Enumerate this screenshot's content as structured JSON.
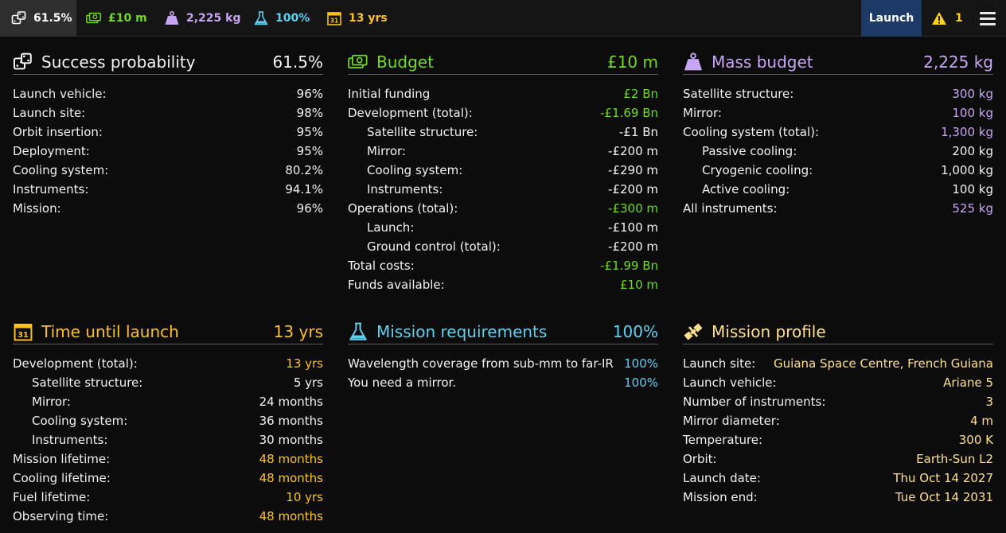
{
  "topbar": {
    "success": "61.5%",
    "budget": "£10 m",
    "mass": "2,225 kg",
    "requirements": "100%",
    "time": "13 yrs",
    "launch_label": "Launch",
    "warning_count": "1"
  },
  "colors": {
    "green": "#6fdc1c",
    "purple": "#c7a6f5",
    "cyan": "#5fd0f0",
    "yellow": "#ffc21a",
    "sand": "#ffe08a",
    "launch_bg": "#1d3a66"
  },
  "success": {
    "title": "Success probability",
    "value": "61.5%",
    "rows": [
      {
        "label": "Launch vehicle:",
        "value": "96%"
      },
      {
        "label": "Launch site:",
        "value": "98%"
      },
      {
        "label": "Orbit insertion:",
        "value": "95%"
      },
      {
        "label": "Deployment:",
        "value": "95%"
      },
      {
        "label": "Cooling system:",
        "value": "80.2%"
      },
      {
        "label": "Instruments:",
        "value": "94.1%"
      },
      {
        "label": "Mission:",
        "value": "96%"
      }
    ]
  },
  "budget": {
    "title": "Budget",
    "value": "£10 m",
    "rows": [
      {
        "label": "Initial funding",
        "value": "£2 Bn"
      },
      {
        "label": "Development (total):",
        "value": "-£1.69 Bn"
      },
      {
        "label": "Satellite structure:",
        "value": "-£1 Bn"
      },
      {
        "label": "Mirror:",
        "value": "-£200 m"
      },
      {
        "label": "Cooling system:",
        "value": "-£290 m"
      },
      {
        "label": "Instruments:",
        "value": "-£200 m"
      },
      {
        "label": "Operations (total):",
        "value": "-£300 m"
      },
      {
        "label": "Launch:",
        "value": "-£100 m"
      },
      {
        "label": "Ground control (total):",
        "value": "-£200 m"
      },
      {
        "label": "Total costs:",
        "value": "-£1.99 Bn"
      },
      {
        "label": "Funds available:",
        "value": "£10 m"
      }
    ]
  },
  "mass": {
    "title": "Mass budget",
    "value": "2,225 kg",
    "rows": [
      {
        "label": "Satellite structure:",
        "value": "300 kg"
      },
      {
        "label": "Mirror:",
        "value": "100 kg"
      },
      {
        "label": "Cooling system (total):",
        "value": "1,300 kg"
      },
      {
        "label": "Passive cooling:",
        "value": "200 kg"
      },
      {
        "label": "Cryogenic cooling:",
        "value": "1,000 kg"
      },
      {
        "label": "Active cooling:",
        "value": "100 kg"
      },
      {
        "label": "All instruments:",
        "value": "525 kg"
      }
    ]
  },
  "time": {
    "title": "Time until launch",
    "value": "13 yrs",
    "rows": [
      {
        "label": "Development (total):",
        "value": "13 yrs"
      },
      {
        "label": "Satellite structure:",
        "value": "5 yrs"
      },
      {
        "label": "Mirror:",
        "value": "24 months"
      },
      {
        "label": "Cooling system:",
        "value": "36 months"
      },
      {
        "label": "Instruments:",
        "value": "30 months"
      },
      {
        "label": "Mission lifetime:",
        "value": "48 months"
      },
      {
        "label": "Cooling lifetime:",
        "value": "48 months"
      },
      {
        "label": "Fuel lifetime:",
        "value": "10 yrs"
      },
      {
        "label": "Observing time:",
        "value": "48 months"
      }
    ]
  },
  "requirements": {
    "title": "Mission requirements",
    "value": "100%",
    "rows": [
      {
        "label": "Wavelength coverage from sub-mm to far-IR",
        "value": "100%"
      },
      {
        "label": "You need a mirror.",
        "value": "100%"
      }
    ]
  },
  "profile": {
    "title": "Mission profile",
    "rows": [
      {
        "label": "Launch site:",
        "value": "Guiana Space Centre, French Guiana"
      },
      {
        "label": "Launch vehicle:",
        "value": "Ariane 5"
      },
      {
        "label": "Number of instruments:",
        "value": "3"
      },
      {
        "label": "Mirror diameter:",
        "value": "4 m"
      },
      {
        "label": "Temperature:",
        "value": "300 K"
      },
      {
        "label": "Orbit:",
        "value": "Earth-Sun L2"
      },
      {
        "label": "Launch date:",
        "value": "Thu Oct 14 2027"
      },
      {
        "label": "Mission end:",
        "value": "Tue Oct 14 2031"
      }
    ]
  }
}
